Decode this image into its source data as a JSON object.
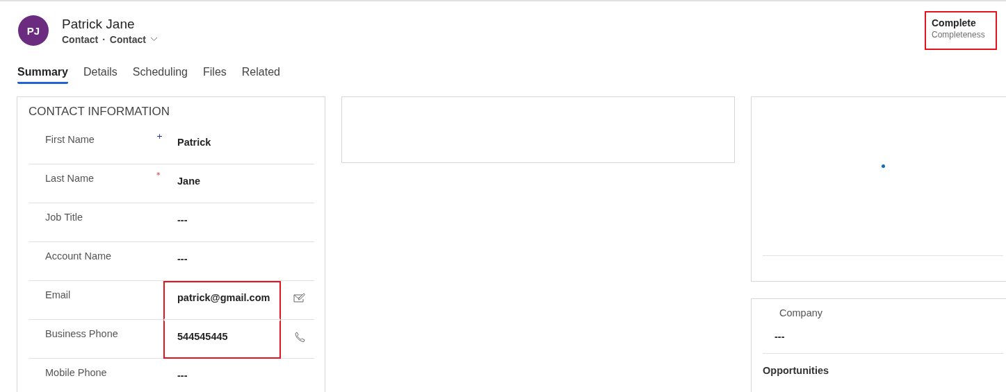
{
  "header": {
    "avatar_initials": "PJ",
    "name": "Patrick Jane",
    "entity": "Contact",
    "separator": "·",
    "form_selector": "Contact",
    "status": {
      "value": "Complete",
      "label": "Completeness",
      "highlighted": true
    }
  },
  "tabs": [
    {
      "label": "Summary",
      "selected": true
    },
    {
      "label": "Details",
      "selected": false
    },
    {
      "label": "Scheduling",
      "selected": false
    },
    {
      "label": "Files",
      "selected": false
    },
    {
      "label": "Related",
      "selected": false
    }
  ],
  "contact_information": {
    "title": "CONTACT INFORMATION",
    "fields": [
      {
        "label": "First Name",
        "requirement": {
          "kind": "recommended",
          "mark": "+"
        },
        "value": "Patrick",
        "highlighted": false
      },
      {
        "label": "Last Name",
        "requirement": {
          "kind": "required",
          "mark": "*"
        },
        "value": "Jane",
        "highlighted": false
      },
      {
        "label": "Job Title",
        "value": "---",
        "highlighted": false
      },
      {
        "label": "Account Name",
        "value": "---",
        "highlighted": false
      },
      {
        "label": "Email",
        "value": "patrick@gmail.com",
        "kind": "email",
        "highlighted": true
      },
      {
        "label": "Business Phone",
        "value": "544545445",
        "kind": "phone",
        "highlighted": true
      },
      {
        "label": "Mobile Phone",
        "value": "---",
        "highlighted": false
      }
    ]
  },
  "right_panel": {
    "loading": true
  },
  "related_panel": {
    "company_label": "Company",
    "company_value": "---",
    "opportunities_title": "Opportunities"
  }
}
